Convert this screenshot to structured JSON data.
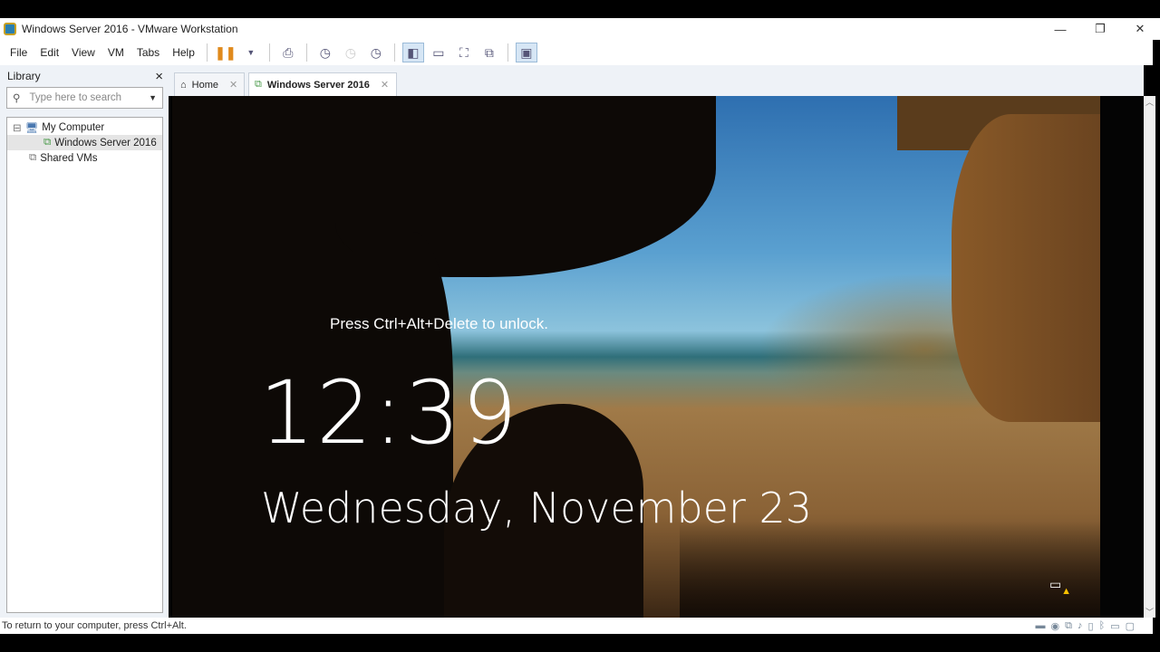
{
  "window": {
    "title": "Windows Server 2016 - VMware Workstation",
    "minimize": "—",
    "restore": "❐",
    "close": "✕"
  },
  "menu": [
    "File",
    "Edit",
    "View",
    "VM",
    "Tabs",
    "Help"
  ],
  "library": {
    "title": "Library",
    "close": "×",
    "search_placeholder": "Type here to search",
    "tree": [
      {
        "label": "My Computer",
        "expander": "⊟"
      },
      {
        "label": "Windows Server 2016"
      },
      {
        "label": "Shared VMs"
      }
    ]
  },
  "tabs": [
    {
      "label": "Home",
      "close": "✕"
    },
    {
      "label": "Windows Server 2016",
      "close": "✕"
    }
  ],
  "lockscreen": {
    "message": "Press Ctrl+Alt+Delete to unlock.",
    "time": "12:39",
    "date": "Wednesday, November 23"
  },
  "status": {
    "text": "To return to your computer, press Ctrl+Alt."
  }
}
